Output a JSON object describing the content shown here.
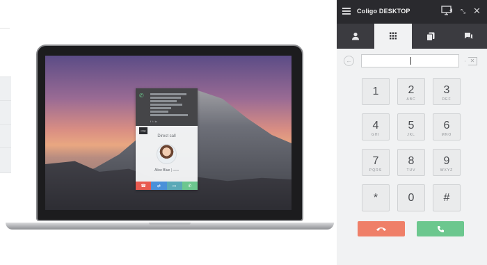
{
  "colors": {
    "titlebar": "#2a2a2e",
    "tabbar": "#3b3b40",
    "panel_bg": "#f1f2f3",
    "end_call": "#ef7f68",
    "start_call": "#6cc78e",
    "card_red": "#e85a4f",
    "card_blue": "#4a90d9",
    "card_teal": "#5aa9b7",
    "card_green": "#6cc78e"
  },
  "app": {
    "title": "Coligo DESKTOP"
  },
  "titlebar_icons": [
    "hamburger-menu-icon",
    "screen-share-icon",
    "collapse-icon",
    "close-icon"
  ],
  "tabs": [
    {
      "name": "contacts",
      "icon": "person-icon",
      "active": false
    },
    {
      "name": "dialpad",
      "icon": "dialpad-icon",
      "active": true
    },
    {
      "name": "history",
      "icon": "copy-icon",
      "active": false
    },
    {
      "name": "chat",
      "icon": "chat-icon",
      "active": false
    }
  ],
  "dialer": {
    "value": "",
    "keys": [
      {
        "digit": "1",
        "letters": ""
      },
      {
        "digit": "2",
        "letters": "ABC"
      },
      {
        "digit": "3",
        "letters": "DEF"
      },
      {
        "digit": "4",
        "letters": "GHI"
      },
      {
        "digit": "5",
        "letters": "JKL"
      },
      {
        "digit": "6",
        "letters": "MNO"
      },
      {
        "digit": "7",
        "letters": "PQRS"
      },
      {
        "digit": "8",
        "letters": "TUV"
      },
      {
        "digit": "9",
        "letters": "WXYZ"
      },
      {
        "digit": "*",
        "letters": ""
      },
      {
        "digit": "0",
        "letters": ""
      },
      {
        "digit": "#",
        "letters": ""
      }
    ]
  },
  "laptop_card": {
    "call_type": "Direct call",
    "contact_name": "Alice Blue",
    "brand": "coligo"
  }
}
